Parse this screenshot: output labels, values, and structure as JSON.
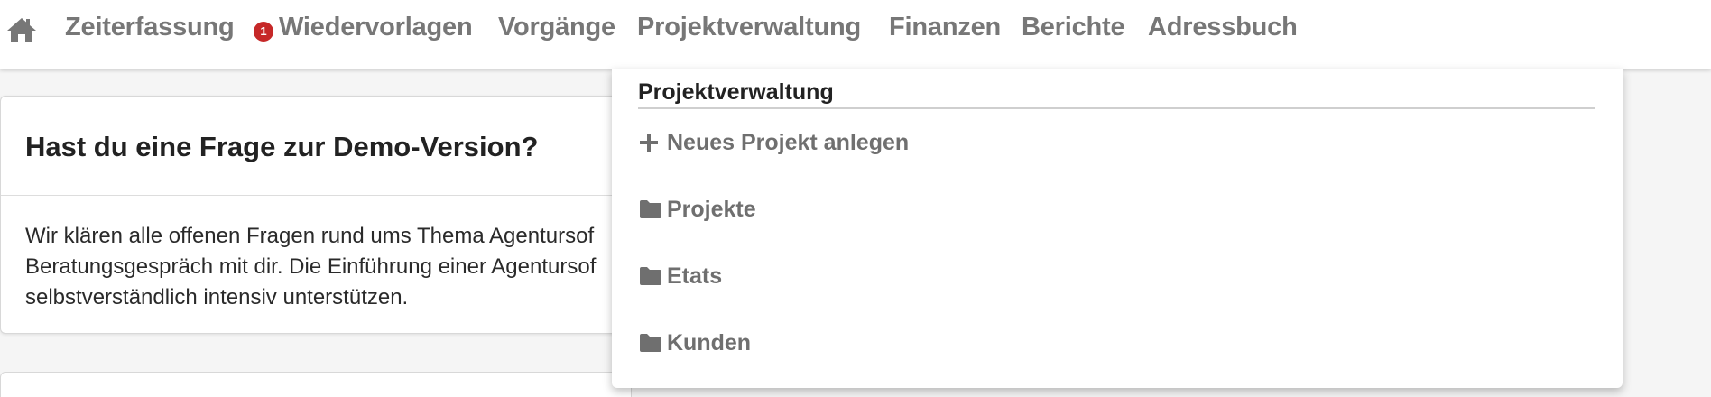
{
  "nav": {
    "items": [
      {
        "label": "Zeiterfassung"
      },
      {
        "label": "Wiedervorlagen",
        "badge": "1"
      },
      {
        "label": "Vorgänge"
      },
      {
        "label": "Projektverwaltung"
      },
      {
        "label": "Finanzen"
      },
      {
        "label": "Berichte"
      },
      {
        "label": "Adressbuch"
      }
    ]
  },
  "card": {
    "title": "Hast du eine Frage zur Demo-Version?",
    "body_lines": [
      "Wir klären alle offenen Fragen rund ums Thema Agentursof",
      "Beratungsgespräch mit dir. Die Einführung einer Agentursof",
      "selbstverständlich intensiv unterstützen."
    ]
  },
  "dropdown": {
    "header": "Projektverwaltung",
    "items": [
      {
        "label": "Neues Projekt anlegen",
        "icon": "plus-icon"
      },
      {
        "label": "Projekte",
        "icon": "folder-icon"
      },
      {
        "label": "Etats",
        "icon": "folder-icon"
      },
      {
        "label": "Kunden",
        "icon": "folder-icon"
      }
    ]
  },
  "colors": {
    "nav_text": "#777777",
    "badge": "#c62828",
    "dropdown_item_text": "#6f6f6f",
    "background": "#f5f5f5"
  }
}
